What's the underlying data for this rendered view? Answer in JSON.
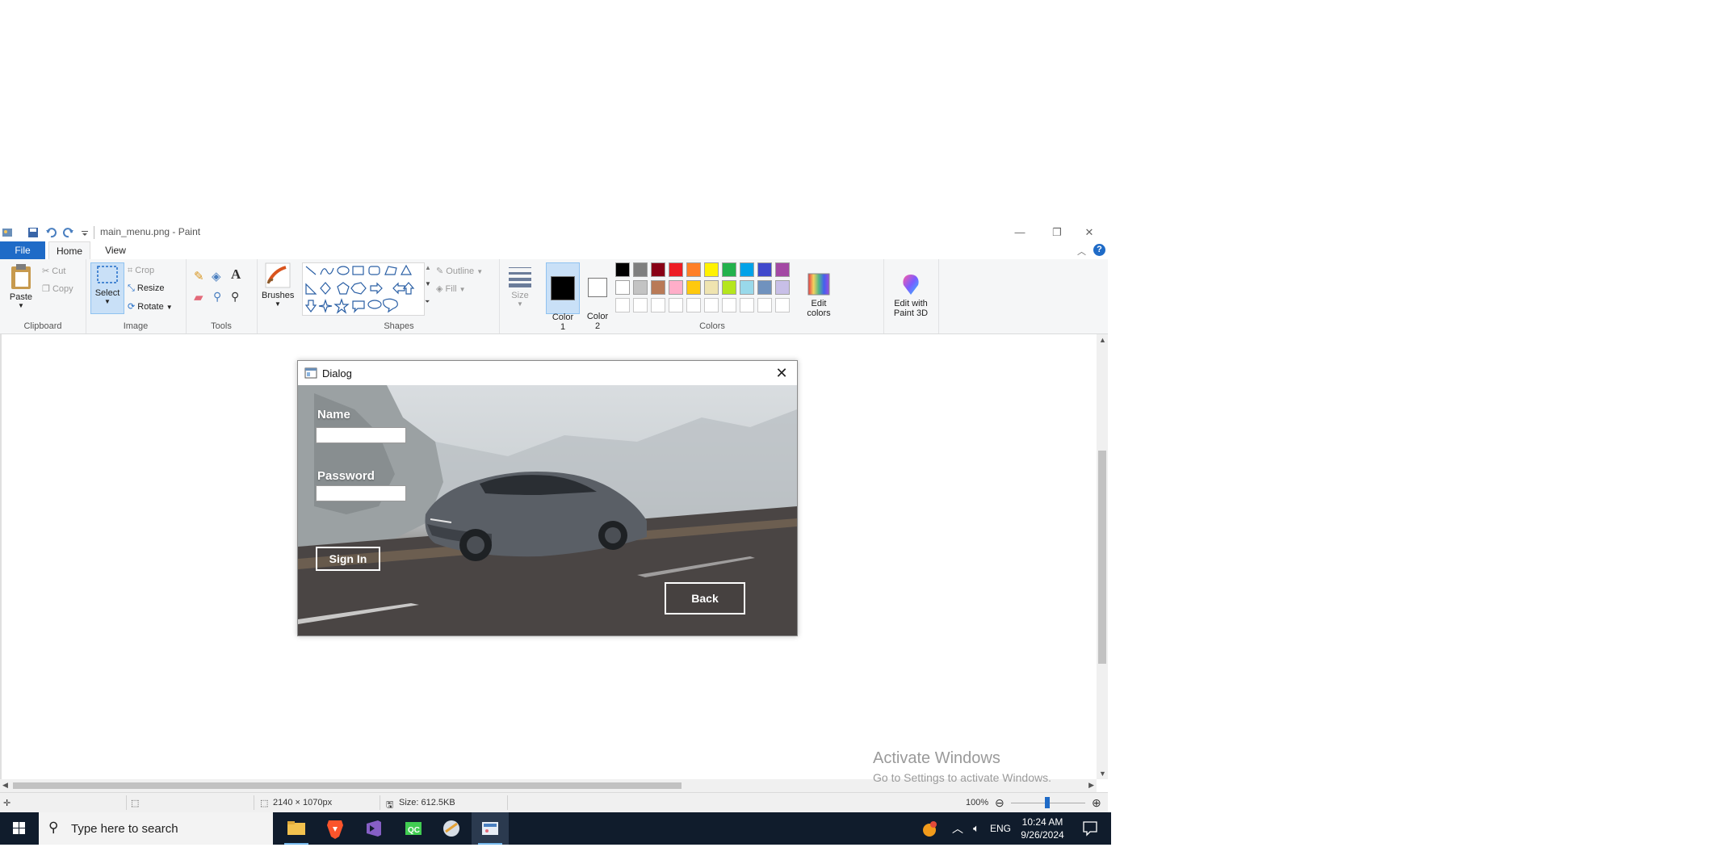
{
  "window": {
    "title": "main_menu.png - Paint",
    "controls": {
      "minimize": "—",
      "restore": "❐",
      "close": "✕"
    }
  },
  "tabs": {
    "file": "File",
    "home": "Home",
    "view": "View"
  },
  "ribbon": {
    "clipboard": {
      "paste": "Paste",
      "cut": "Cut",
      "copy": "Copy",
      "group_label": "Clipboard"
    },
    "image": {
      "select": "Select",
      "crop": "Crop",
      "resize": "Resize",
      "rotate": "Rotate",
      "group_label": "Image"
    },
    "tools": {
      "group_label": "Tools"
    },
    "brushes": {
      "label": "Brushes"
    },
    "shapes": {
      "outline": "Outline",
      "fill": "Fill",
      "group_label": "Shapes"
    },
    "size": {
      "label": "Size"
    },
    "colors": {
      "color1_label": "Color\n1",
      "color2_label": "Color\n2",
      "edit_colors": "Edit\ncolors",
      "group_label": "Colors",
      "row1": [
        "#000000",
        "#7f7f7f",
        "#880015",
        "#ed1c24",
        "#ff7f27",
        "#fff200",
        "#22b14c",
        "#00a2e8",
        "#3f48cc",
        "#a349a4"
      ],
      "row2": [
        "#ffffff",
        "#c3c3c3",
        "#b97a57",
        "#ffaec9",
        "#ffc90e",
        "#efe4b0",
        "#b5e61d",
        "#99d9ea",
        "#7092be",
        "#c8bfe7"
      ],
      "row3": [
        "#ffffff",
        "#ffffff",
        "#ffffff",
        "#ffffff",
        "#ffffff",
        "#ffffff",
        "#ffffff",
        "#ffffff",
        "#ffffff",
        "#ffffff"
      ],
      "color1": "#000000",
      "color2": "#ffffff"
    },
    "paint3d": {
      "label": "Edit with\nPaint 3D"
    }
  },
  "dialog": {
    "title": "Dialog",
    "name_label": "Name",
    "password_label": "Password",
    "signin_label": "Sign In",
    "back_label": "Back"
  },
  "status": {
    "dimensions": "2140 × 1070px",
    "size": "Size: 612.5KB",
    "zoom": "100%"
  },
  "watermark": {
    "line1": "Activate Windows",
    "line2": "Go to Settings to activate Windows."
  },
  "taskbar": {
    "search_placeholder": "Type here to search",
    "language": "ENG",
    "time": "10:24 AM",
    "date": "9/26/2024"
  }
}
